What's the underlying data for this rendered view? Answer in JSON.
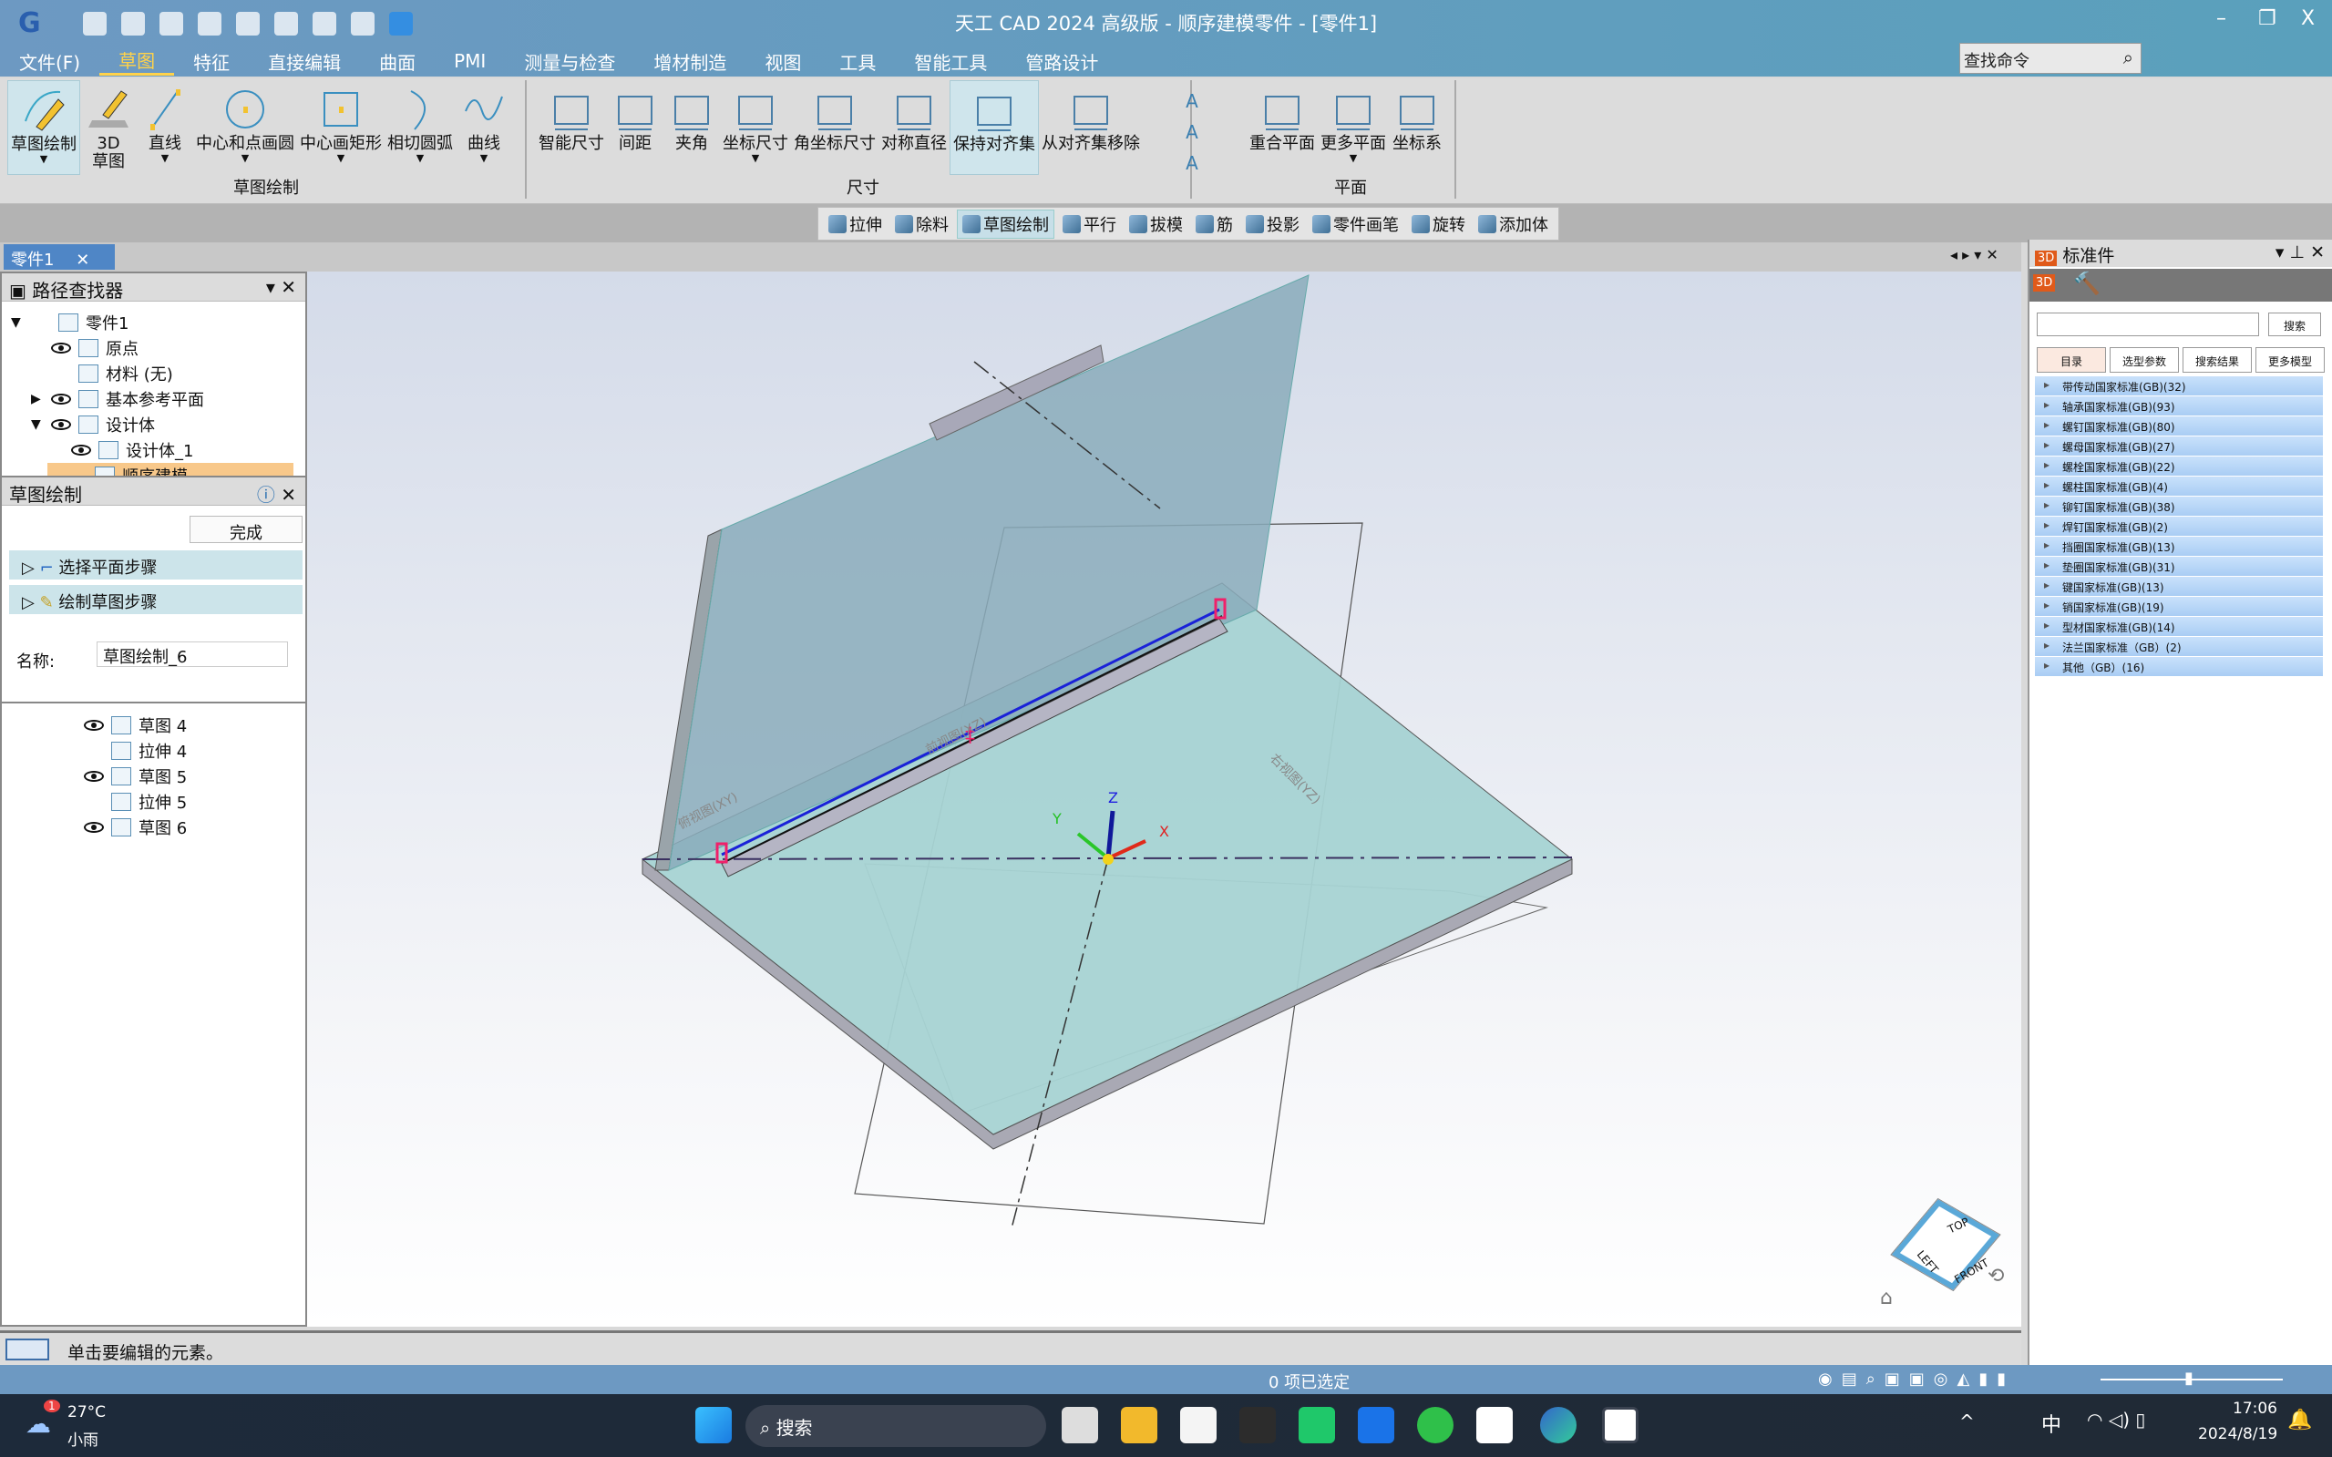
{
  "titlebar": {
    "title": "天工 CAD 2024 高级版 - 顺序建模零件 - [零件1]",
    "minimize": "–",
    "restore": "❐",
    "close": "X"
  },
  "menubar": {
    "items": [
      "文件(F)",
      "草图",
      "特征",
      "直接编辑",
      "曲面",
      "PMI",
      "测量与检查",
      "增材制造",
      "视图",
      "工具",
      "智能工具",
      "管路设计"
    ],
    "active": "草图",
    "search_placeholder": "查找命令"
  },
  "ribbon": {
    "groups": [
      {
        "label": "草图绘制",
        "items": [
          {
            "label": "草图绘制",
            "icon": "sketch-pencil",
            "dropdown": true,
            "active": true
          },
          {
            "label": "3D\n草图",
            "icon": "sketch-3d"
          },
          {
            "label": "直线",
            "icon": "line",
            "dropdown": true
          },
          {
            "label": "中心和点画圆",
            "icon": "circle",
            "dropdown": true
          },
          {
            "label": "中心画矩形",
            "icon": "rectangle",
            "dropdown": true
          },
          {
            "label": "相切圆弧",
            "icon": "arc",
            "dropdown": true
          },
          {
            "label": "曲线",
            "icon": "curve",
            "dropdown": true
          }
        ]
      },
      {
        "label": "尺寸",
        "items": [
          {
            "label": "智能尺寸",
            "icon": "smart-dim"
          },
          {
            "label": "间距",
            "icon": "distance"
          },
          {
            "label": "夹角",
            "icon": "angle"
          },
          {
            "label": "坐标尺寸",
            "icon": "coord-dim",
            "dropdown": true
          },
          {
            "label": "角坐标尺寸",
            "icon": "angle-coord"
          },
          {
            "label": "对称直径",
            "icon": "sym-diameter"
          },
          {
            "label": "保持对齐集",
            "icon": "keep-align",
            "active": true
          },
          {
            "label": "从对齐集移除",
            "icon": "remove-align"
          }
        ]
      },
      {
        "label": "平面",
        "items": [
          {
            "label": "重合平面",
            "icon": "plane"
          },
          {
            "label": "更多平面",
            "icon": "more-planes",
            "dropdown": true
          },
          {
            "label": "坐标系",
            "icon": "csys"
          }
        ]
      }
    ]
  },
  "feature_toolbar": [
    {
      "label": "拉伸"
    },
    {
      "label": "除料"
    },
    {
      "label": "草图绘制",
      "active": true
    },
    {
      "label": "平行"
    },
    {
      "label": "拔模"
    },
    {
      "label": "筋"
    },
    {
      "label": "投影"
    },
    {
      "label": "零件画笔"
    },
    {
      "label": "旋转"
    },
    {
      "label": "添加体"
    }
  ],
  "doc_tab": "零件1",
  "pathfinder": {
    "title": "路径查找器",
    "tree": [
      {
        "label": "零件1",
        "level": 0,
        "expander": "▼",
        "eye": false
      },
      {
        "label": "原点",
        "level": 1,
        "eye": true
      },
      {
        "label": "材料 (无)",
        "level": 1,
        "eye": false
      },
      {
        "label": "基本参考平面",
        "level": 1,
        "expander": "▶",
        "eye": true
      },
      {
        "label": "设计体",
        "level": 1,
        "expander": "▼",
        "eye": true
      },
      {
        "label": "设计体_1",
        "level": 2,
        "eye": true
      },
      {
        "label": "顺序建模",
        "level": 1,
        "highlight": true
      }
    ],
    "lower_tree": [
      {
        "label": "草图 4",
        "eye": true
      },
      {
        "label": "拉伸 4",
        "eye": false
      },
      {
        "label": "草图 5",
        "eye": true
      },
      {
        "label": "拉伸 5",
        "eye": false
      },
      {
        "label": "草图 6",
        "eye": true
      }
    ]
  },
  "sketch_panel": {
    "title": "草图绘制",
    "finish": "完成",
    "steps": [
      "选择平面步骤",
      "绘制草图步骤"
    ],
    "name_label": "名称:",
    "name_value": "草图绘制_6"
  },
  "viewport": {
    "plane_labels": [
      "前视图(XZ)",
      "俯视图(XY)",
      "右视图(YZ)"
    ],
    "axes": [
      "X",
      "Y",
      "Z"
    ],
    "viewcube": [
      "TOP",
      "LEFT",
      "FRONT"
    ]
  },
  "std_parts": {
    "title": "标准件",
    "search_button": "搜索",
    "tabs": [
      "目录",
      "选型参数",
      "搜索结果",
      "更多模型"
    ],
    "items": [
      "带传动国家标准(GB)(32)",
      "轴承国家标准(GB)(93)",
      "螺钉国家标准(GB)(80)",
      "螺母国家标准(GB)(27)",
      "螺栓国家标准(GB)(22)",
      "螺柱国家标准(GB)(4)",
      "铆钉国家标准(GB)(38)",
      "焊钉国家标准(GB)(2)",
      "挡圈国家标准(GB)(13)",
      "垫圈国家标准(GB)(31)",
      "键国家标准(GB)(13)",
      "销国家标准(GB)(19)",
      "型材国家标准(GB)(14)",
      "法兰国家标准（GB）(2)",
      "其他（GB）(16)"
    ]
  },
  "status": {
    "prompt": "单击要编辑的元素。",
    "selection": "0 项已选定"
  },
  "taskbar": {
    "weather_temp": "27°C",
    "weather_desc": "小雨",
    "weather_badge": "1",
    "search": "搜索",
    "ime": "中",
    "time": "17:06",
    "date": "2024/8/19"
  }
}
